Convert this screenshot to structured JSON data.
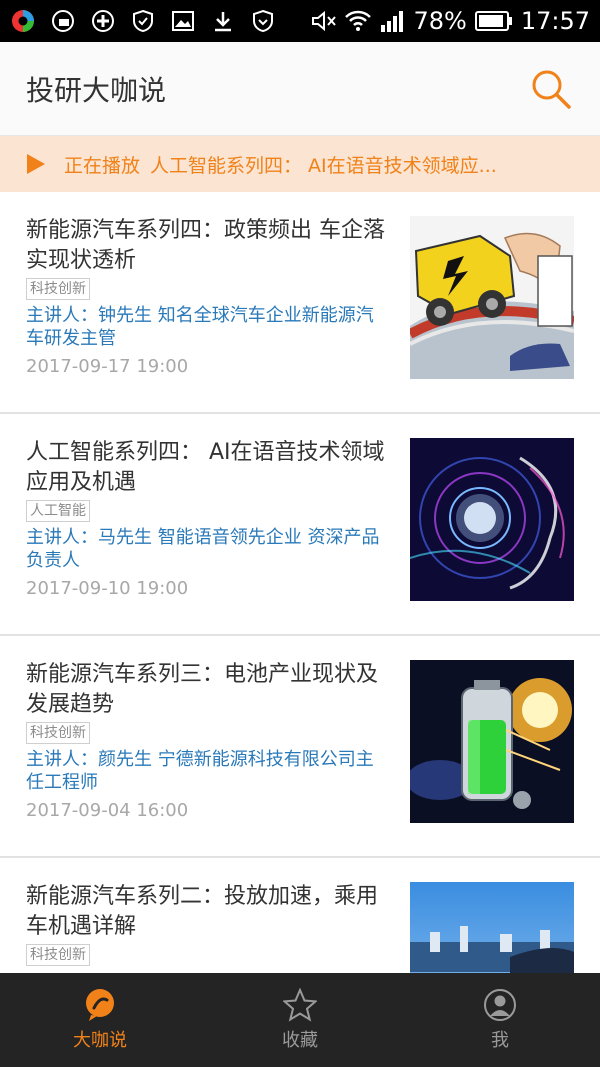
{
  "status_bar": {
    "battery": "78%",
    "time": "17:57",
    "left_icons": [
      "app-circle-icon",
      "sim-icon",
      "plus-circle-icon",
      "shield-check-icon",
      "image-icon",
      "download-icon",
      "shield-icon"
    ],
    "right_icons": [
      "mute-icon",
      "wifi-icon",
      "signal-icon",
      "battery-icon"
    ]
  },
  "header": {
    "title": "投研大咖说",
    "search_icon": "search-icon"
  },
  "now_playing": {
    "status": "正在播放",
    "title": "人工智能系列四： AI在语音技术领域应..."
  },
  "items": [
    {
      "title": "新能源汽车系列四：政策频出 车企落实现状透析",
      "tag": "科技创新",
      "speaker": "主讲人：钟先生 知名全球汽车企业新能源汽车研发主管",
      "date": "2017-09-17 19:00"
    },
    {
      "title": "人工智能系列四： AI在语音技术领域应用及机遇",
      "tag": "人工智能",
      "speaker": "主讲人：马先生 智能语音领先企业 资深产品负责人",
      "date": "2017-09-10 19:00"
    },
    {
      "title": "新能源汽车系列三：电池产业现状及发展趋势",
      "tag": "科技创新",
      "speaker": "主讲人：颜先生 宁德新能源科技有限公司主任工程师",
      "date": "2017-09-04 16:00"
    },
    {
      "title": "新能源汽车系列二：投放加速，乘用车机遇详解",
      "tag": "科技创新",
      "speaker": "",
      "date": ""
    }
  ],
  "tabs": [
    {
      "label": "大咖说",
      "icon": "chat-bubble-icon",
      "active": true
    },
    {
      "label": "收藏",
      "icon": "star-icon",
      "active": false
    },
    {
      "label": "我",
      "icon": "user-icon",
      "active": false
    }
  ],
  "colors": {
    "accent": "#f08219",
    "link": "#2a79b9",
    "nowplaying_bg": "#fbe4d2",
    "tabbar_bg": "#242424"
  }
}
